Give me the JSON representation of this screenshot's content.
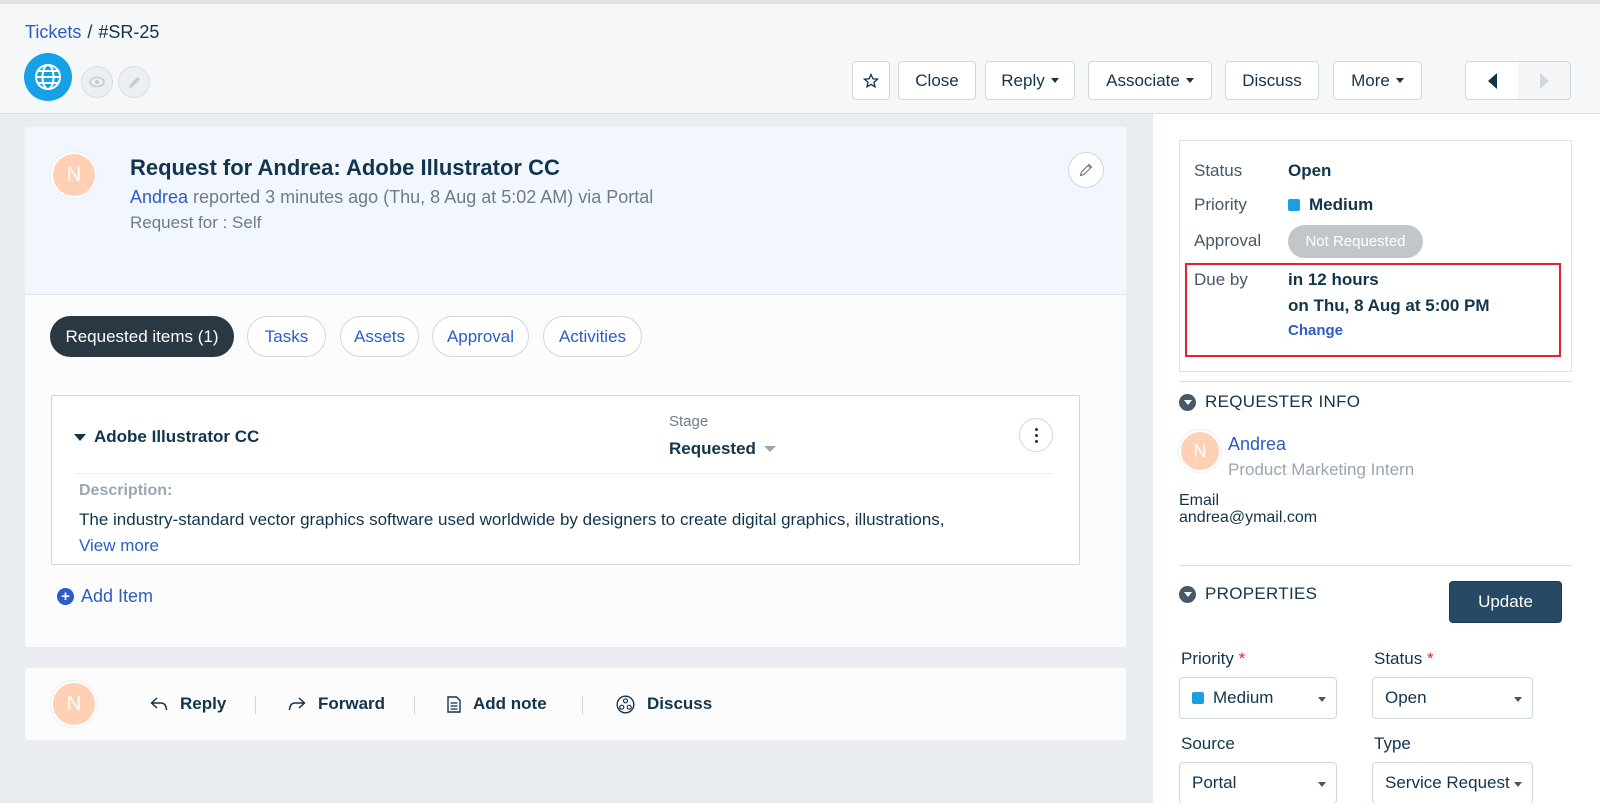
{
  "breadcrumb": {
    "parent": "Tickets",
    "separator": "/",
    "current": "#SR-25"
  },
  "toolbar": {
    "star_icon": "star-icon",
    "close": "Close",
    "reply": "Reply",
    "associate": "Associate",
    "discuss": "Discuss",
    "more": "More"
  },
  "ticket": {
    "avatar_initial": "N",
    "title": "Request for Andrea: Adobe Illustrator CC",
    "requester": "Andrea",
    "reported": " reported 3 minutes ago (Thu, 8 Aug at 5:02 AM) via Portal",
    "request_for": "Request for : Self"
  },
  "tabs": [
    {
      "label": "Requested items (1)",
      "active": true
    },
    {
      "label": "Tasks",
      "active": false
    },
    {
      "label": "Assets",
      "active": false
    },
    {
      "label": "Approval",
      "active": false
    },
    {
      "label": "Activities",
      "active": false
    }
  ],
  "item": {
    "name": "Adobe Illustrator CC",
    "stage_label": "Stage",
    "stage_value": "Requested",
    "description_label": "Description:",
    "description": "The industry-standard vector graphics software used worldwide by designers to create digital graphics, illustrations,",
    "view_more": "View more"
  },
  "add_item": "Add Item",
  "reply_bar": {
    "avatar_initial": "N",
    "reply": "Reply",
    "forward": "Forward",
    "add_note": "Add note",
    "discuss": "Discuss"
  },
  "status_panel": {
    "status_label": "Status",
    "status_value": "Open",
    "priority_label": "Priority",
    "priority_value": "Medium",
    "priority_color": "#1a9fe0",
    "approval_label": "Approval",
    "approval_value": "Not Requested",
    "due_label": "Due by",
    "due_relative": "in 12 hours",
    "due_absolute": "on Thu, 8 Aug at 5:00 PM",
    "change": "Change"
  },
  "requester_info": {
    "heading": "REQUESTER INFO",
    "avatar_initial": "N",
    "name": "Andrea",
    "role": "Product Marketing Intern",
    "email_label": "Email",
    "email": "andrea@ymail.com"
  },
  "properties": {
    "heading": "PROPERTIES",
    "update": "Update",
    "priority_label": "Priority",
    "priority_value": "Medium",
    "status_label": "Status",
    "status_value": "Open",
    "source_label": "Source",
    "source_value": "Portal",
    "type_label": "Type",
    "type_value": "Service Request",
    "required_mark": "*"
  },
  "colors": {
    "accent": "#2c5cc5",
    "highlight": "#e3262d",
    "brand": "#16a1e7"
  }
}
